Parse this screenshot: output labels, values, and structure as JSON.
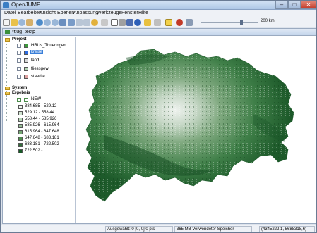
{
  "window": {
    "title": "OpenJUMP"
  },
  "menu": [
    "Datei",
    "Bearbeiten",
    "Ansicht",
    "Ebenen",
    "Anpassung",
    "Werkzeuge",
    "Fenster",
    "Hilfe"
  ],
  "toolbar": {
    "scale_label": "200 km",
    "icons": [
      "new-project-icon",
      "open-icon",
      "zoom-in-icon",
      "zoom-out-icon",
      "pan-icon",
      "globe-icon",
      "zoom-previous-icon",
      "zoom-next-icon",
      "zoom-layer-icon",
      "undo-icon",
      "redo-icon",
      "select-icon",
      "measure-icon",
      "info-icon",
      "warning-icon",
      "wms-icon",
      "snap-icon",
      "attribute-icon",
      "scale-slider-icon"
    ]
  },
  "frame": {
    "title": "*tlug_testp"
  },
  "tree": {
    "project": {
      "label": "Projekt",
      "layers": [
        {
          "label": "HRUs_Thueringen",
          "color": "#3c9a3c",
          "checked": false
        },
        {
          "label": "kreise",
          "color": "#2d6be0",
          "checked": false,
          "selected": true
        },
        {
          "label": "land",
          "color": "#d9d9d9",
          "checked": false
        },
        {
          "label": "fliessgew",
          "color": "#b6d7b6",
          "checked": false
        },
        {
          "label": "staedte",
          "color": "#e0a0a0",
          "checked": false
        }
      ]
    },
    "system": {
      "label": "System"
    },
    "ergebnis": {
      "label": "Ergebnis",
      "layer": {
        "label": "NEW",
        "checked": true
      },
      "classes": [
        {
          "label": "384.685 - 529.12",
          "color": "#eef4ee"
        },
        {
          "label": "529.12 - 558.44",
          "color": "#d3e6d3"
        },
        {
          "label": "558.44 - 585.926",
          "color": "#b7d4b7"
        },
        {
          "label": "585.926 - 615.964",
          "color": "#97c097"
        },
        {
          "label": "615.964 - 647.648",
          "color": "#74a874"
        },
        {
          "label": "647.648 - 683.181",
          "color": "#4f8d4f"
        },
        {
          "label": "683.181 - 722.502",
          "color": "#2f6f38"
        },
        {
          "label": "722.502 -",
          "color": "#185a27"
        }
      ]
    }
  },
  "status": {
    "selection": "Ausgewählt: 0 [0, 0] 0 pts",
    "memory": "365 MB Verwendeter Speicher",
    "coordinates": "(4345222,1, 5688318,6)"
  },
  "colors": {
    "map_light": "#c9d8c9",
    "map_dark": "#1e5a2a",
    "selection": "#3a7fd9"
  }
}
